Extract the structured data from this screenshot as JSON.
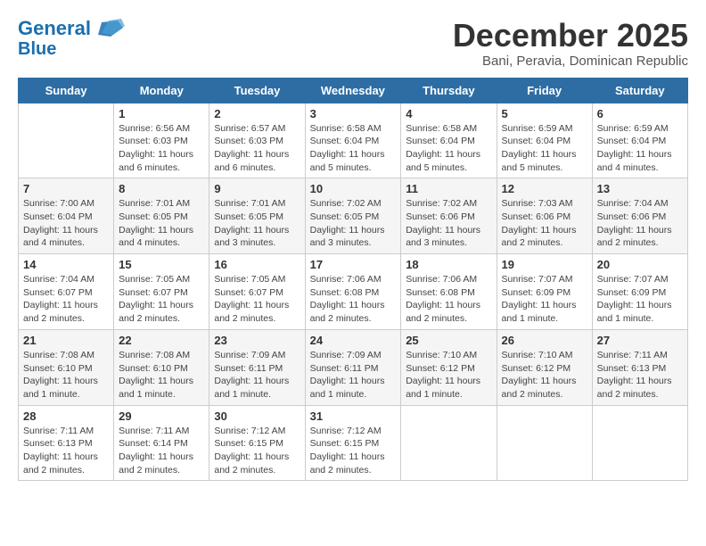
{
  "header": {
    "logo_line1": "General",
    "logo_line2": "Blue",
    "month": "December 2025",
    "location": "Bani, Peravia, Dominican Republic"
  },
  "days_of_week": [
    "Sunday",
    "Monday",
    "Tuesday",
    "Wednesday",
    "Thursday",
    "Friday",
    "Saturday"
  ],
  "weeks": [
    [
      {
        "num": "",
        "info": ""
      },
      {
        "num": "1",
        "info": "Sunrise: 6:56 AM\nSunset: 6:03 PM\nDaylight: 11 hours\nand 6 minutes."
      },
      {
        "num": "2",
        "info": "Sunrise: 6:57 AM\nSunset: 6:03 PM\nDaylight: 11 hours\nand 6 minutes."
      },
      {
        "num": "3",
        "info": "Sunrise: 6:58 AM\nSunset: 6:04 PM\nDaylight: 11 hours\nand 5 minutes."
      },
      {
        "num": "4",
        "info": "Sunrise: 6:58 AM\nSunset: 6:04 PM\nDaylight: 11 hours\nand 5 minutes."
      },
      {
        "num": "5",
        "info": "Sunrise: 6:59 AM\nSunset: 6:04 PM\nDaylight: 11 hours\nand 5 minutes."
      },
      {
        "num": "6",
        "info": "Sunrise: 6:59 AM\nSunset: 6:04 PM\nDaylight: 11 hours\nand 4 minutes."
      }
    ],
    [
      {
        "num": "7",
        "info": "Sunrise: 7:00 AM\nSunset: 6:04 PM\nDaylight: 11 hours\nand 4 minutes."
      },
      {
        "num": "8",
        "info": "Sunrise: 7:01 AM\nSunset: 6:05 PM\nDaylight: 11 hours\nand 4 minutes."
      },
      {
        "num": "9",
        "info": "Sunrise: 7:01 AM\nSunset: 6:05 PM\nDaylight: 11 hours\nand 3 minutes."
      },
      {
        "num": "10",
        "info": "Sunrise: 7:02 AM\nSunset: 6:05 PM\nDaylight: 11 hours\nand 3 minutes."
      },
      {
        "num": "11",
        "info": "Sunrise: 7:02 AM\nSunset: 6:06 PM\nDaylight: 11 hours\nand 3 minutes."
      },
      {
        "num": "12",
        "info": "Sunrise: 7:03 AM\nSunset: 6:06 PM\nDaylight: 11 hours\nand 2 minutes."
      },
      {
        "num": "13",
        "info": "Sunrise: 7:04 AM\nSunset: 6:06 PM\nDaylight: 11 hours\nand 2 minutes."
      }
    ],
    [
      {
        "num": "14",
        "info": "Sunrise: 7:04 AM\nSunset: 6:07 PM\nDaylight: 11 hours\nand 2 minutes."
      },
      {
        "num": "15",
        "info": "Sunrise: 7:05 AM\nSunset: 6:07 PM\nDaylight: 11 hours\nand 2 minutes."
      },
      {
        "num": "16",
        "info": "Sunrise: 7:05 AM\nSunset: 6:07 PM\nDaylight: 11 hours\nand 2 minutes."
      },
      {
        "num": "17",
        "info": "Sunrise: 7:06 AM\nSunset: 6:08 PM\nDaylight: 11 hours\nand 2 minutes."
      },
      {
        "num": "18",
        "info": "Sunrise: 7:06 AM\nSunset: 6:08 PM\nDaylight: 11 hours\nand 2 minutes."
      },
      {
        "num": "19",
        "info": "Sunrise: 7:07 AM\nSunset: 6:09 PM\nDaylight: 11 hours\nand 1 minute."
      },
      {
        "num": "20",
        "info": "Sunrise: 7:07 AM\nSunset: 6:09 PM\nDaylight: 11 hours\nand 1 minute."
      }
    ],
    [
      {
        "num": "21",
        "info": "Sunrise: 7:08 AM\nSunset: 6:10 PM\nDaylight: 11 hours\nand 1 minute."
      },
      {
        "num": "22",
        "info": "Sunrise: 7:08 AM\nSunset: 6:10 PM\nDaylight: 11 hours\nand 1 minute."
      },
      {
        "num": "23",
        "info": "Sunrise: 7:09 AM\nSunset: 6:11 PM\nDaylight: 11 hours\nand 1 minute."
      },
      {
        "num": "24",
        "info": "Sunrise: 7:09 AM\nSunset: 6:11 PM\nDaylight: 11 hours\nand 1 minute."
      },
      {
        "num": "25",
        "info": "Sunrise: 7:10 AM\nSunset: 6:12 PM\nDaylight: 11 hours\nand 1 minute."
      },
      {
        "num": "26",
        "info": "Sunrise: 7:10 AM\nSunset: 6:12 PM\nDaylight: 11 hours\nand 2 minutes."
      },
      {
        "num": "27",
        "info": "Sunrise: 7:11 AM\nSunset: 6:13 PM\nDaylight: 11 hours\nand 2 minutes."
      }
    ],
    [
      {
        "num": "28",
        "info": "Sunrise: 7:11 AM\nSunset: 6:13 PM\nDaylight: 11 hours\nand 2 minutes."
      },
      {
        "num": "29",
        "info": "Sunrise: 7:11 AM\nSunset: 6:14 PM\nDaylight: 11 hours\nand 2 minutes."
      },
      {
        "num": "30",
        "info": "Sunrise: 7:12 AM\nSunset: 6:15 PM\nDaylight: 11 hours\nand 2 minutes."
      },
      {
        "num": "31",
        "info": "Sunrise: 7:12 AM\nSunset: 6:15 PM\nDaylight: 11 hours\nand 2 minutes."
      },
      {
        "num": "",
        "info": ""
      },
      {
        "num": "",
        "info": ""
      },
      {
        "num": "",
        "info": ""
      }
    ]
  ]
}
